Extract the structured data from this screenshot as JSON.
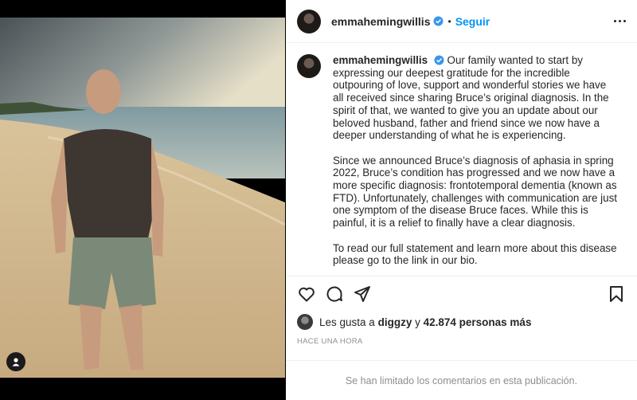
{
  "post": {
    "username": "emmahemingwillis",
    "follow_label": "Seguir",
    "separator": "•",
    "caption_paragraphs": [
      "Our family wanted to start by expressing our deepest gratitude for the incredible outpouring of love, support and wonderful stories we have all received since sharing Bruce’s original diagnosis. In the spirit of that, we wanted to give you an update about our beloved husband, father and friend since we now have a deeper understanding of what he is experiencing.",
      "Since we announced Bruce’s diagnosis of aphasia in spring 2022, Bruce’s condition has progressed and we now have a more specific diagnosis: frontotemporal dementia (known as FTD). Unfortunately, challenges with communication are just one symptom of the disease Bruce faces. While this is painful, it is a relief to finally have a clear diagnosis.",
      "To read our full statement and learn more about this disease please go to the link in our bio."
    ],
    "likes": {
      "prefix": "Les gusta a",
      "user": "diggzy",
      "joiner": "y",
      "count_text": "42.874 personas más"
    },
    "timestamp": "HACE UNA HORA",
    "comments_limited": "Se han limitado los comentarios en esta publicación."
  },
  "icons": {
    "like": "heart-icon",
    "comment": "comment-icon",
    "share": "share-icon",
    "save": "bookmark-icon",
    "more": "more-options-icon",
    "verified": "verified-badge-icon",
    "tag": "user-tag-icon"
  },
  "colors": {
    "accent": "#0095f6",
    "verified": "#3897f0",
    "muted": "#8e8e8e"
  }
}
